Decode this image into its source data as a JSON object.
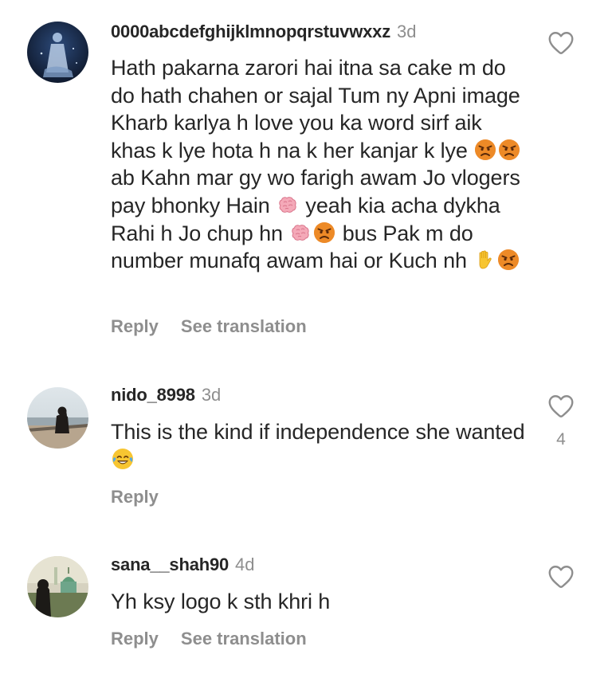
{
  "comments": [
    {
      "username": "0000abcdefghijklmnopqrstuvwxxz",
      "time": "3d",
      "text_segments": [
        "Hath pakarna zarori hai itna sa cake m do do hath chahen or sajal Tum ny Apni image Kharb karlya h love you ka word sirf aik khas k lye hota h na k her kanjar k lye ",
        " ab Kahn mar gy wo farigh awam Jo vlogers pay bhonky Hain ",
        " yeah kia acha dykha Rahi h Jo chup hn ",
        " bus Pak m do number munafq awam hai or Kuch nh "
      ],
      "emojis": [
        "angry-emoji",
        "angry-emoji",
        "brain-emoji",
        "brain-emoji",
        "angry-emoji",
        "raised-hand-emoji",
        "angry-emoji"
      ],
      "reply_label": "Reply",
      "translate_label": "See translation",
      "like_icon": "heart-outline-icon"
    },
    {
      "username": "nido_8998",
      "time": "3d",
      "text": "This is the kind if independence she wanted ",
      "emojis": [
        "tears-of-joy-emoji"
      ],
      "reply_label": "Reply",
      "likes": "4",
      "like_icon": "heart-outline-icon"
    },
    {
      "username": "sana__shah90",
      "time": "4d",
      "text": "Yh ksy logo k sth khri h",
      "reply_label": "Reply",
      "translate_label": "See translation",
      "like_icon": "heart-outline-icon"
    }
  ],
  "colors": {
    "primary_text": "#262626",
    "secondary_text": "#8e8e8e",
    "background": "#ffffff"
  }
}
